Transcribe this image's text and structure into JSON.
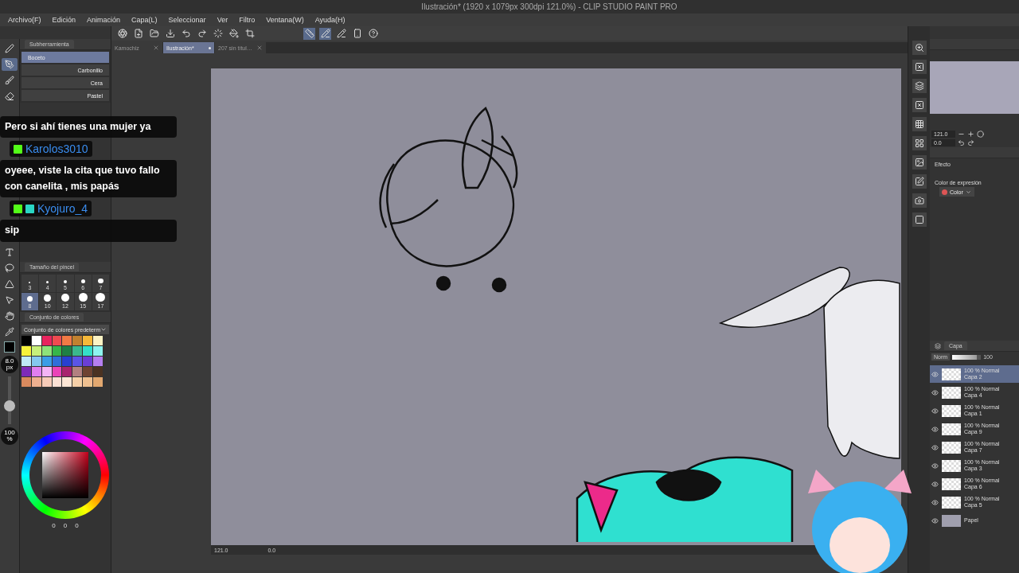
{
  "window": {
    "title": "Ilustración* (1920 x 1079px 300dpi 121.0%) - CLIP STUDIO PAINT PRO"
  },
  "menu": [
    "Archivo(F)",
    "Edición",
    "Animación",
    "Capa(L)",
    "Seleccionar",
    "Ver",
    "Filtro",
    "Ventana(W)",
    "Ayuda(H)"
  ],
  "tabs": [
    {
      "label": "Kamochiz",
      "selected": false
    },
    {
      "label": "Ilustración*",
      "selected": true
    },
    {
      "label": "207 sin títul…",
      "selected": false
    }
  ],
  "subtool": {
    "title": "Subherramienta",
    "items": [
      {
        "label": "Boceto",
        "selected": true
      },
      {
        "label": "Carbonillo",
        "selected": false
      },
      {
        "label": "Cera",
        "selected": false
      },
      {
        "label": "Pastel",
        "selected": false
      }
    ]
  },
  "brush_size": {
    "title": "Tamaño del pincel",
    "sizes": [
      {
        "label": "3",
        "selected": false
      },
      {
        "label": "4",
        "selected": false
      },
      {
        "label": "5",
        "selected": false
      },
      {
        "label": "6",
        "selected": false
      },
      {
        "label": "7",
        "selected": false
      },
      {
        "label": "8",
        "selected": true
      },
      {
        "label": "10",
        "selected": false
      },
      {
        "label": "12",
        "selected": false
      },
      {
        "label": "15",
        "selected": false
      },
      {
        "label": "17",
        "selected": false
      }
    ]
  },
  "color_set": {
    "title": "Conjunto de colores",
    "preset": "Conjunto de colores predeterm",
    "swatches": [
      {
        "color": "#000000"
      },
      {
        "color": "#ffffff"
      },
      {
        "color": "#e8245e"
      },
      {
        "color": "#ef4a50"
      },
      {
        "color": "#f27a45"
      },
      {
        "color": "#c2812f"
      },
      {
        "color": "#f5b93a"
      },
      {
        "color": "#fbf3c4"
      },
      {
        "color": "#f7f23a"
      },
      {
        "color": "#c7f07a"
      },
      {
        "color": "#8ee27a"
      },
      {
        "color": "#37b54a"
      },
      {
        "color": "#1f7f45"
      },
      {
        "color": "#3bb88d"
      },
      {
        "color": "#35e0c8"
      },
      {
        "color": "#8ef4f0"
      },
      {
        "color": "#bfe9f7"
      },
      {
        "color": "#84c8ef"
      },
      {
        "color": "#3b9de6"
      },
      {
        "color": "#2f6fd9"
      },
      {
        "color": "#2740d0"
      },
      {
        "color": "#5a55e6"
      },
      {
        "color": "#6b3fd6"
      },
      {
        "color": "#b67ff0"
      },
      {
        "color": "#7d2ab8"
      },
      {
        "color": "#e07ef0"
      },
      {
        "color": "#f4b4f5"
      },
      {
        "color": "#ea43b8"
      },
      {
        "color": "#a8246e"
      },
      {
        "color": "#b28080"
      },
      {
        "color": "#6e4332"
      },
      {
        "color": "#4a3222"
      },
      {
        "color": "#d98a5e"
      },
      {
        "color": "#eeb090"
      },
      {
        "color": "#f7cbb8"
      },
      {
        "color": "#fbe0d4"
      },
      {
        "color": "#fde6d5"
      },
      {
        "color": "#f6d0a8"
      },
      {
        "color": "#efc090"
      },
      {
        "color": "#e2a870"
      }
    ]
  },
  "tool_strip": {
    "size": "8.0",
    "size_unit": "px",
    "opacity": "100",
    "opacity_unit": "%",
    "size_slider": {
      "level": 0.35
    }
  },
  "color_values": [
    "0",
    "0",
    "0"
  ],
  "navigator": {
    "zoom": "121.0",
    "angle": "0.0"
  },
  "properties": {
    "effect_label": "Efecto",
    "expression_label": "Color de expresión",
    "expression": "Color"
  },
  "layers": {
    "title": "Capa",
    "blend": "Norm",
    "opacity": "100",
    "opacity_slider": {
      "level": 0.85
    },
    "items": [
      {
        "kind": "layer",
        "mode": "100 % Normal",
        "name": "Capa 2",
        "selected": true
      },
      {
        "kind": "layer",
        "mode": "100 % Normal",
        "name": "Capa 4",
        "selected": false
      },
      {
        "kind": "layer",
        "mode": "100 % Normal",
        "name": "Capa 1",
        "selected": false
      },
      {
        "kind": "layer",
        "mode": "100 % Normal",
        "name": "Capa 9",
        "selected": false
      },
      {
        "kind": "layer",
        "mode": "100 % Normal",
        "name": "Capa 7",
        "selected": false
      },
      {
        "kind": "layer",
        "mode": "100 % Normal",
        "name": "Capa 3",
        "selected": false
      },
      {
        "kind": "layer",
        "mode": "100 % Normal",
        "name": "Capa 6",
        "selected": false
      },
      {
        "kind": "layer",
        "mode": "100 % Normal",
        "name": "Capa 5",
        "selected": false
      },
      {
        "kind": "paper",
        "name": "Papel",
        "selected": false
      }
    ]
  },
  "status": {
    "zoom": "121.0",
    "angle": "0.0"
  },
  "chat": [
    {
      "message": "Pero si ahí tienes una mujer ya"
    },
    {
      "user": "Karolos3010",
      "message": "oyeee, viste la cita que tuvo fallo con canelita , mis papás"
    },
    {
      "user": "Kyojuro_4",
      "extra_badge": true,
      "message": "sip"
    }
  ]
}
